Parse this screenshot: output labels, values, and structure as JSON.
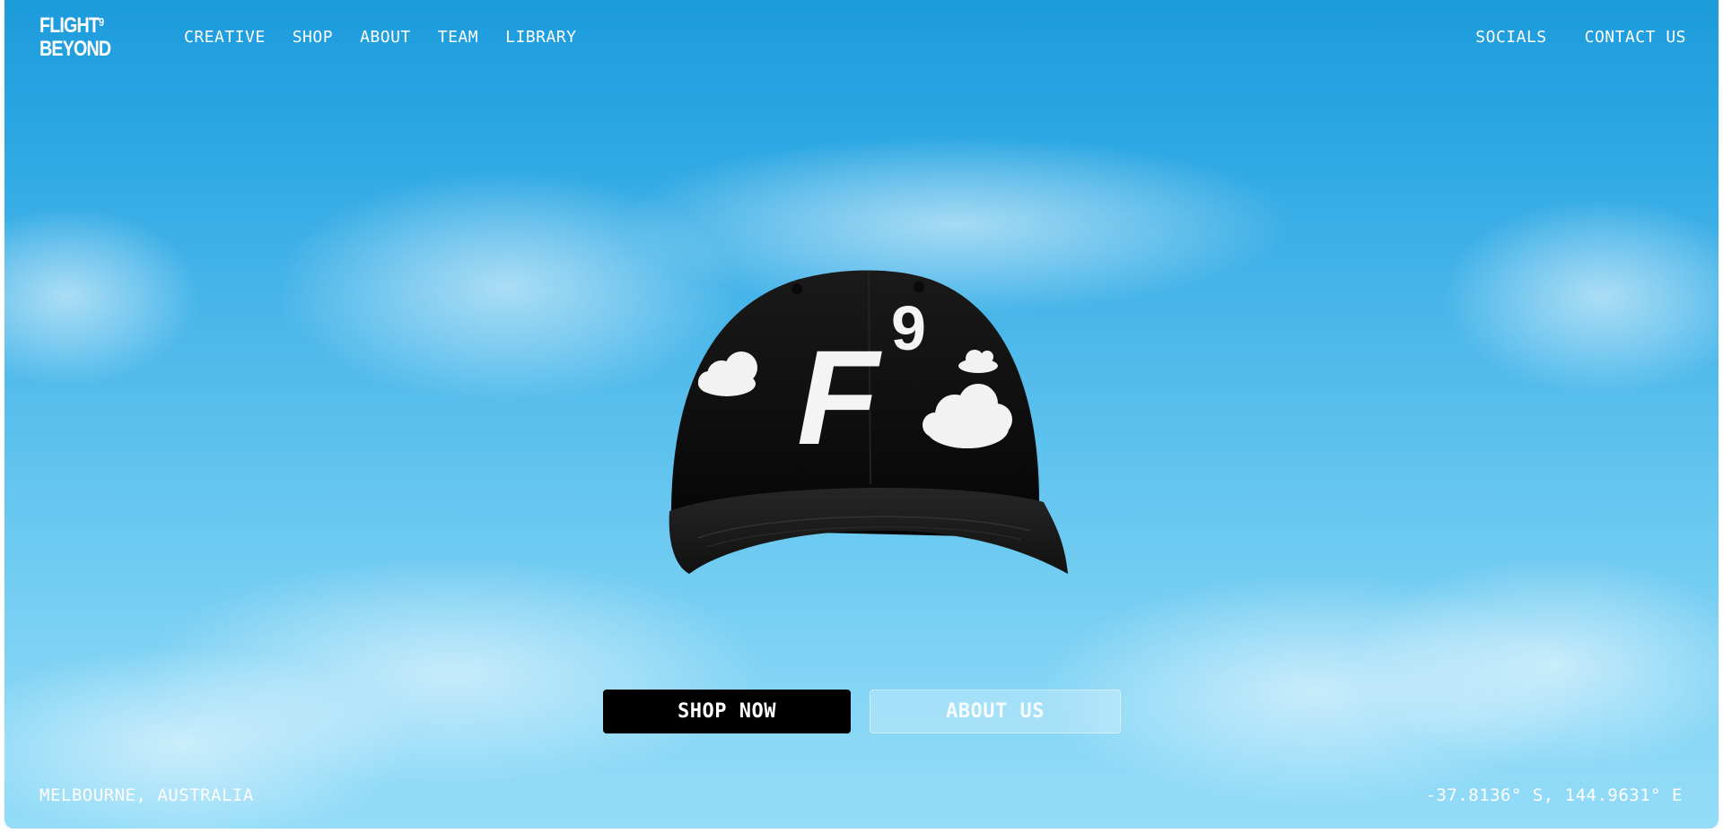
{
  "header": {
    "logo_line1": "FLIGHT",
    "logo_sup": "9",
    "logo_line2": "BEYOND",
    "nav_left": [
      "CREATIVE",
      "SHOP",
      "ABOUT",
      "TEAM",
      "LIBRARY"
    ],
    "nav_right": [
      "SOCIALS",
      "CONTACT US"
    ]
  },
  "hero": {
    "product": "cap-image",
    "cap_logo_letter": "F",
    "cap_logo_sup": "9"
  },
  "cta": {
    "shop_now": "SHOP NOW",
    "about_us": "ABOUT US"
  },
  "footer": {
    "location": "MELBOURNE, AUSTRALIA",
    "coordinates": "-37.8136° S, 144.9631° E"
  },
  "colors": {
    "sky_top": "#1c9bdb",
    "sky_bottom": "#94dcf8",
    "cap": "#0d0d0d",
    "button_primary": "#000000"
  }
}
